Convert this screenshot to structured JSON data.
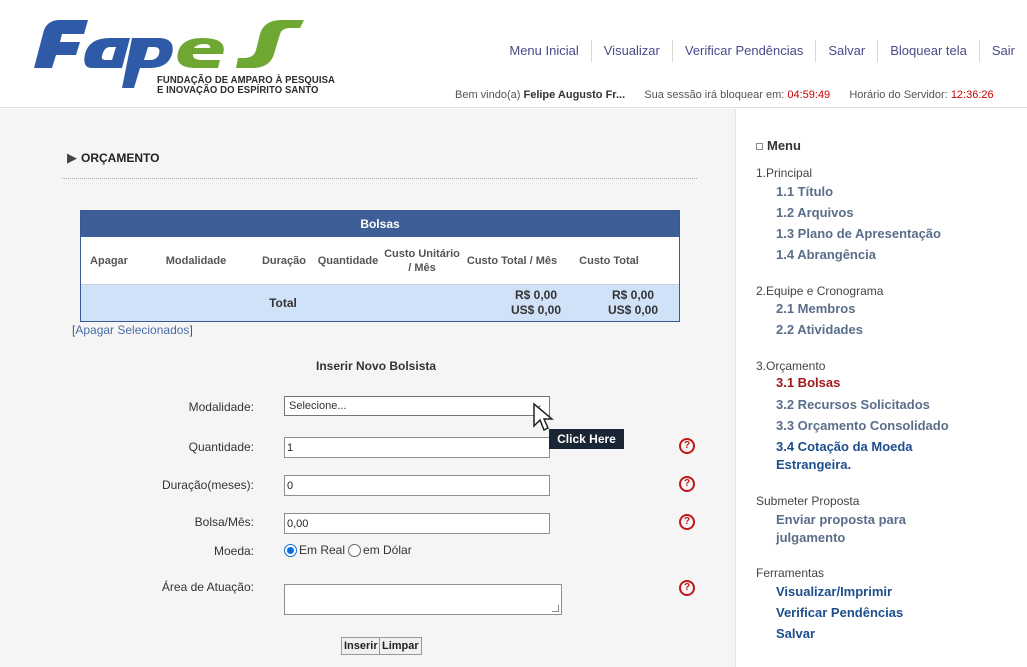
{
  "header": {
    "logo_text": "FAPES",
    "logo_sub_1": "FUNDAÇÃO DE AMPARO À PESQUISA",
    "logo_sub_2": "E INOVAÇÃO DO ESPÍRITO SANTO",
    "nav": [
      "Menu Inicial",
      "Visualizar",
      "Verificar Pendências",
      "Salvar",
      "Bloquear tela",
      "Sair"
    ],
    "welcome_prefix": "Bem vindo(a)",
    "welcome_name": "Felipe Augusto Fr...",
    "session_prefix": "Sua sessão irá bloquear em:",
    "session_time": "04:59:49",
    "server_prefix": "Horário do Servidor:",
    "server_time": "12:36:26"
  },
  "main": {
    "section_title": "ORÇAMENTO",
    "table": {
      "title": "Bolsas",
      "columns": [
        "Apagar",
        "Modalidade",
        "Duração",
        "Quantidade",
        "Custo Unitário / Mês",
        "Custo Total / Mês",
        "Custo Total"
      ],
      "total_label": "Total",
      "total_month_brl": "R$ 0,00",
      "total_month_usd": "US$ 0,00",
      "total_brl": "R$ 0,00",
      "total_usd": "US$ 0,00"
    },
    "delete_selected": "Apagar Selecionados",
    "form": {
      "title": "Inserir Novo Bolsista",
      "modalidade_label": "Modalidade:",
      "modalidade_value": "Selecione...",
      "quantidade_label": "Quantidade:",
      "quantidade_value": "1",
      "duracao_label": "Duração(meses):",
      "duracao_value": "0",
      "bolsa_label": "Bolsa/Mês:",
      "bolsa_value": "0,00",
      "moeda_label": "Moeda:",
      "moeda_real": "Em Real",
      "moeda_dolar": "em Dólar",
      "area_label": "Área de Atuação:",
      "insert_button": "Inserir",
      "clear_button": "Limpar",
      "help_glyph": "?"
    },
    "tooltip": "Click Here"
  },
  "sidebar": {
    "title": "Menu",
    "groups": [
      {
        "label": "1.Principal",
        "items": [
          "1.1 Título",
          "1.2 Arquivos",
          "1.3 Plano de Apresentação",
          "1.4 Abrangência"
        ]
      },
      {
        "label": "2.Equipe e Cronograma",
        "items": [
          "2.1 Membros",
          "2.2 Atividades"
        ]
      },
      {
        "label": "3.Orçamento",
        "items": [
          "3.1 Bolsas",
          "3.2 Recursos Solicitados",
          "3.3 Orçamento Consolidado",
          "3.4 Cotação da Moeda",
          "Estrangeira."
        ]
      },
      {
        "label": "Submeter Proposta",
        "items": [
          "Enviar proposta para",
          "julgamento"
        ]
      },
      {
        "label": "Ferramentas",
        "items": [
          "Visualizar/Imprimir",
          "Verificar Pendências",
          "Salvar"
        ]
      }
    ]
  },
  "colors": {
    "brand_blue": "#2f5aa8",
    "brand_green": "#6ea832",
    "table_header": "#3e5e98",
    "active_menu": "#a01818"
  }
}
